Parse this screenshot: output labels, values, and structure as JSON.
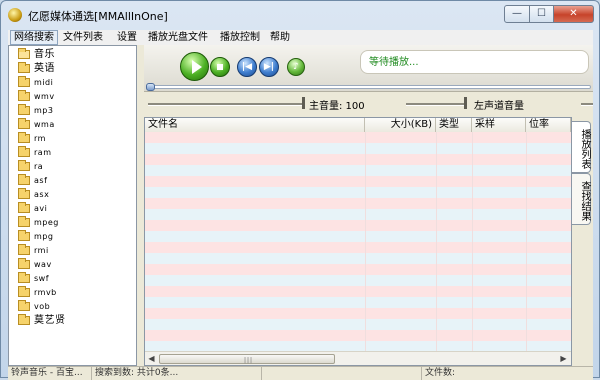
{
  "window": {
    "title": "亿愿媒体通选[MMAllInOne]",
    "controls": {
      "minimize": "—",
      "maximize": "☐",
      "close": "✕"
    }
  },
  "menu": [
    {
      "label": "网络搜索",
      "active": true
    },
    {
      "label": "文件列表"
    },
    {
      "label": "设置"
    },
    {
      "label": "播放光盘文件"
    },
    {
      "label": "播放控制"
    },
    {
      "label": "帮助"
    }
  ],
  "tree": [
    {
      "label": "音乐",
      "open": true
    },
    {
      "label": "英语"
    },
    {
      "label": "midi"
    },
    {
      "label": "wmv"
    },
    {
      "label": "mp3"
    },
    {
      "label": "wma"
    },
    {
      "label": "rm"
    },
    {
      "label": "ram"
    },
    {
      "label": "ra"
    },
    {
      "label": "asf"
    },
    {
      "label": "asx"
    },
    {
      "label": "avi"
    },
    {
      "label": "mpeg"
    },
    {
      "label": "mpg"
    },
    {
      "label": "rmi"
    },
    {
      "label": "wav"
    },
    {
      "label": "swf"
    },
    {
      "label": "rmvb"
    },
    {
      "label": "vob"
    },
    {
      "label": "莫艺贤"
    }
  ],
  "player": {
    "status": "等待播放...",
    "prev_icon": "skip-previous-icon",
    "next_icon": "skip-next-icon",
    "prev_glyph": "|◀",
    "next_glyph": "▶|",
    "volume_glyph": "♪",
    "progress": 0.0
  },
  "volume": {
    "master_label": "主音量: 100",
    "left_label": "左声道音量"
  },
  "list": {
    "columns": [
      "文件名",
      "大小(KB)",
      "类型",
      "采样",
      "位率"
    ],
    "rows": 20
  },
  "side_tabs": [
    "播放列表",
    "查找结果"
  ],
  "statusbar": [
    "铃声音乐 - 百宝...",
    "搜索到数: 共计0条...",
    "",
    "文件数:"
  ],
  "colors": {
    "row_pink": "#fde3e3",
    "row_blue": "#e7f3f8",
    "status_green": "#1e8a1e"
  }
}
